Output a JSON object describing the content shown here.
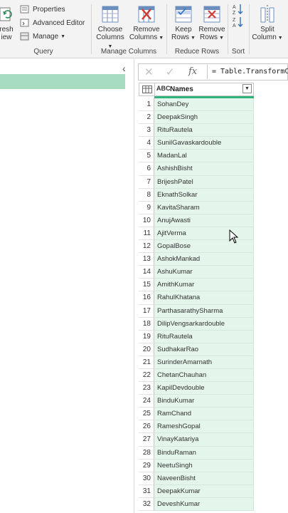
{
  "ribbon": {
    "refresh": {
      "line1": "resh",
      "line2": "iew"
    },
    "properties": "Properties",
    "advanced_editor": "Advanced Editor",
    "manage": "Manage",
    "groups": {
      "query": "Query",
      "manage_columns": "Manage Columns",
      "reduce_rows": "Reduce Rows",
      "sort": "Sort"
    },
    "choose_columns": {
      "line1": "Choose",
      "line2": "Columns"
    },
    "remove_columns": {
      "line1": "Remove",
      "line2": "Columns"
    },
    "keep_rows": {
      "line1": "Keep",
      "line2": "Rows"
    },
    "remove_rows": {
      "line1": "Remove",
      "line2": "Rows"
    },
    "split_column": {
      "line1": "Split",
      "line2": "Column"
    }
  },
  "formula_bar": {
    "fx": "fx",
    "text": "= Table.TransformColumnTypes("
  },
  "grid": {
    "type_icon": "ABC",
    "column_name": "Names",
    "rows": [
      "SohanDey",
      "DeepakSingh",
      "RituRautela",
      "SunilGavaskardouble",
      "MadanLal",
      "AshishBisht",
      "BrijeshPatel",
      "EknathSolkar",
      "KavitaSharam",
      "AnujAwasti",
      "AjitVerma",
      "GopalBose",
      "AshokMankad",
      "AshuKumar",
      "AmithKumar",
      "RahulKhatana",
      "ParthasarathySharma",
      "DilipVengsarkardouble",
      "RituRautela",
      "SudhakarRao",
      "SurinderAmarnath",
      "ChetanChauhan",
      "KapilDevdouble",
      "BinduKumar",
      "RamChand",
      "RameshGopal",
      "VinayKatariya",
      "BinduRaman",
      "NeetuSingh",
      "NaveenBisht",
      "DeepakKumar",
      "DeveshKumar"
    ]
  },
  "colors": {
    "accent_green": "#2fb37a",
    "selection": "#a7dcc0",
    "cell_bg": "#e4f5ec"
  }
}
